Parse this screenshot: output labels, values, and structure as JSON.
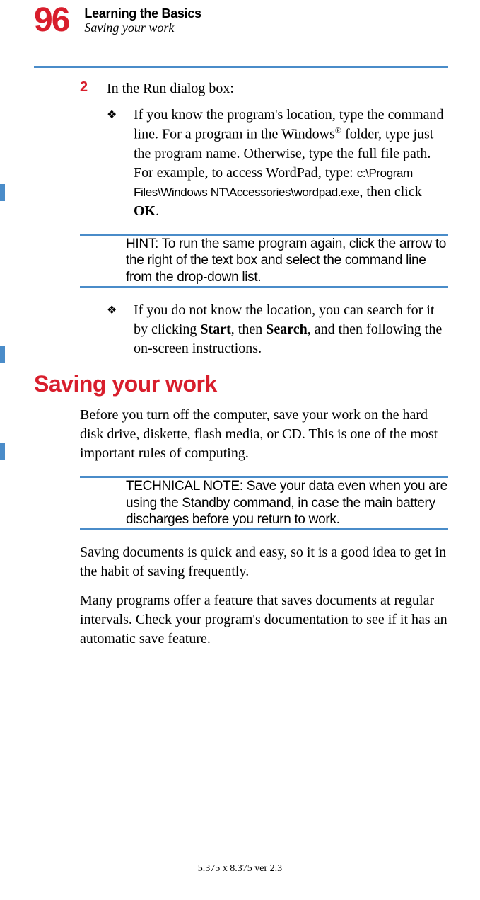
{
  "page_number": "96",
  "chapter_title": "Learning the Basics",
  "section_subtitle": "Saving your work",
  "step_number": "2",
  "step_text": "In the Run dialog box:",
  "bullet1_pre": "If you know the program's location, type the command line. For a program in the Windows",
  "bullet1_sup": "®",
  "bullet1_mid": " folder, type just the program name. Otherwise, type the full file path. For example, to access WordPad, type: ",
  "bullet1_mono": "c:\\Program Files\\Windows NT\\Accessories\\wordpad.exe",
  "bullet1_post1": ", then click ",
  "bullet1_ok": "OK",
  "bullet1_post2": ".",
  "hint_label": "HINT: ",
  "hint_text": "To run the same program again, click the arrow to the right of the text box and select the command line from the drop-down list.",
  "bullet2_pre": "If you do not know the location, you can search for it by clicking ",
  "bullet2_b1": "Start",
  "bullet2_mid": ", then ",
  "bullet2_b2": "Search",
  "bullet2_post": ", and then following the on-screen instructions.",
  "heading": "Saving your work",
  "para1": "Before you turn off the computer, save your work on the hard disk drive, diskette, flash media, or CD. This is one of the most important rules of computing.",
  "tech_label": "TECHNICAL NOTE: ",
  "tech_text": "Save your data even when you are using the Standby command, in case the main battery discharges before you return to work.",
  "para2": "Saving documents is quick and easy, so it is a good idea to get in the habit of saving frequently.",
  "para3": "Many programs offer a feature that saves documents at regular intervals. Check your program's documentation to see if it has an automatic save feature.",
  "footer": "5.375 x 8.375 ver 2.3"
}
